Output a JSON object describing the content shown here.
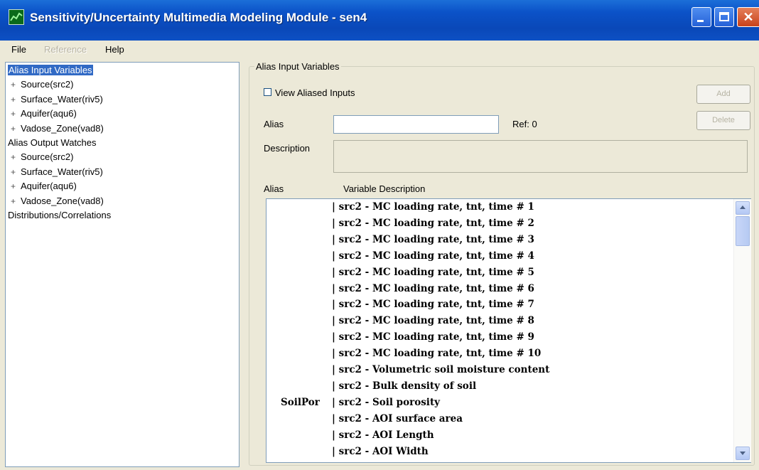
{
  "window": {
    "title": "Sensitivity/Uncertainty Multimedia Modeling Module - sen4"
  },
  "menu": {
    "file": "File",
    "reference": "Reference",
    "help": "Help"
  },
  "tree": {
    "items": [
      {
        "label": "Alias Input Variables",
        "level": 0,
        "expander": "",
        "selected": true
      },
      {
        "label": "Source(src2)",
        "level": 1,
        "expander": "+"
      },
      {
        "label": "Surface_Water(riv5)",
        "level": 1,
        "expander": "+"
      },
      {
        "label": "Aquifer(aqu6)",
        "level": 1,
        "expander": "+"
      },
      {
        "label": "Vadose_Zone(vad8)",
        "level": 1,
        "expander": "+"
      },
      {
        "label": "Alias Output Watches",
        "level": 0,
        "expander": ""
      },
      {
        "label": "Source(src2)",
        "level": 1,
        "expander": "+"
      },
      {
        "label": "Surface_Water(riv5)",
        "level": 1,
        "expander": "+"
      },
      {
        "label": "Aquifer(aqu6)",
        "level": 1,
        "expander": "+"
      },
      {
        "label": "Vadose_Zone(vad8)",
        "level": 1,
        "expander": "+"
      },
      {
        "label": "Distributions/Correlations",
        "level": 0,
        "expander": ""
      }
    ]
  },
  "panel": {
    "legend": "Alias Input Variables",
    "view_aliased": "View Aliased Inputs",
    "add": "Add",
    "delete": "Delete",
    "alias_label": "Alias",
    "alias_value": "",
    "ref": "Ref: 0",
    "description_label": "Description",
    "col_alias": "Alias",
    "col_desc": "Variable Description"
  },
  "list": [
    {
      "alias": "",
      "desc": "| src2 - MC loading rate, tnt, time # 1"
    },
    {
      "alias": "",
      "desc": "| src2 - MC loading rate, tnt, time # 2"
    },
    {
      "alias": "",
      "desc": "| src2 - MC loading rate, tnt, time # 3"
    },
    {
      "alias": "",
      "desc": "| src2 - MC loading rate, tnt, time # 4"
    },
    {
      "alias": "",
      "desc": "| src2 - MC loading rate, tnt, time # 5"
    },
    {
      "alias": "",
      "desc": "| src2 - MC loading rate, tnt, time # 6"
    },
    {
      "alias": "",
      "desc": "| src2 - MC loading rate, tnt, time # 7"
    },
    {
      "alias": "",
      "desc": "| src2 - MC loading rate, tnt, time # 8"
    },
    {
      "alias": "",
      "desc": "| src2 - MC loading rate, tnt, time # 9"
    },
    {
      "alias": "",
      "desc": "| src2 - MC loading rate, tnt, time # 10"
    },
    {
      "alias": "",
      "desc": "| src2 - Volumetric soil moisture content"
    },
    {
      "alias": "",
      "desc": "| src2 - Bulk density of soil"
    },
    {
      "alias": "SoilPor",
      "desc": "| src2 - Soil porosity"
    },
    {
      "alias": "",
      "desc": "| src2 - AOI surface area"
    },
    {
      "alias": "",
      "desc": "| src2 - AOI Length"
    },
    {
      "alias": "",
      "desc": "| src2 - AOI Width"
    }
  ]
}
